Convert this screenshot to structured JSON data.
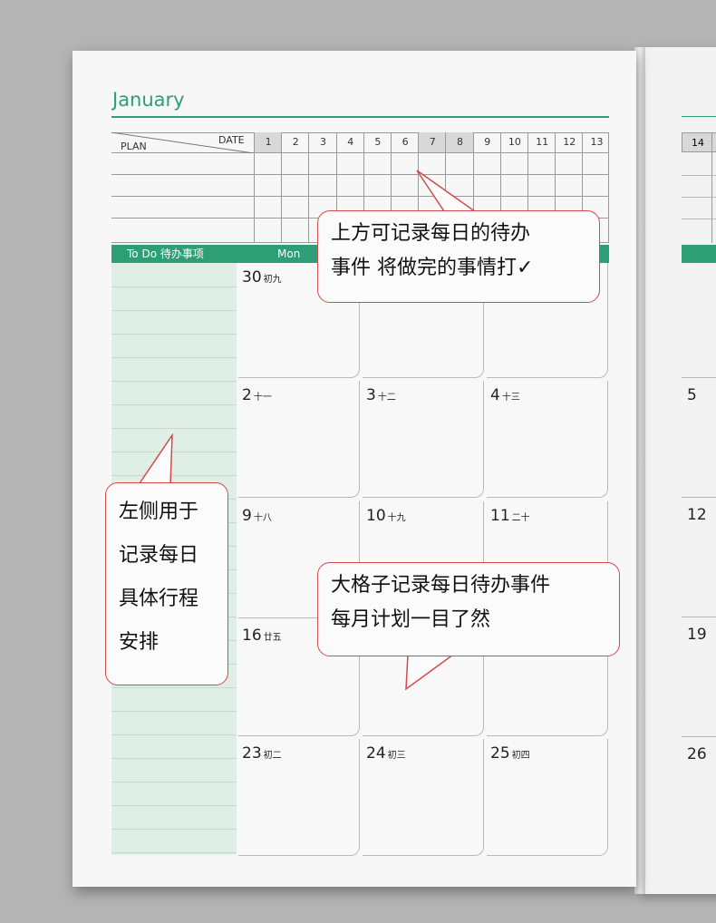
{
  "month": "January",
  "plan_table": {
    "date_label": "DATE",
    "plan_label": "PLAN",
    "days": [
      "1",
      "2",
      "3",
      "4",
      "5",
      "6",
      "7",
      "8",
      "9",
      "10",
      "11",
      "12",
      "13"
    ],
    "shaded": [
      "1",
      "7",
      "8"
    ]
  },
  "header": {
    "todo_label": "To Do  待办事项",
    "weekday_mon": "Mon"
  },
  "calendar": {
    "rows": [
      [
        {
          "day": "30",
          "lunar": "初九"
        }
      ],
      [
        {
          "day": "2",
          "lunar": "十一"
        },
        {
          "day": "3",
          "lunar": "十二"
        },
        {
          "day": "4",
          "lunar": "十三"
        }
      ],
      [
        {
          "day": "9",
          "lunar": "十八"
        },
        {
          "day": "10",
          "lunar": "十九"
        },
        {
          "day": "11",
          "lunar": "二十"
        }
      ],
      [
        {
          "day": "16",
          "lunar": "廿五"
        }
      ],
      [
        {
          "day": "23",
          "lunar": "初二"
        },
        {
          "day": "24",
          "lunar": "初三"
        },
        {
          "day": "25",
          "lunar": "初四"
        }
      ]
    ]
  },
  "right_page": {
    "first_date": "14",
    "days": [
      "5",
      "12",
      "19",
      "26"
    ]
  },
  "callouts": {
    "top": [
      "上方可记录每日的待办",
      "事件 将做完的事情打✓"
    ],
    "left": [
      "左侧用于",
      "记录每日",
      "具体行程",
      "安排"
    ],
    "bottom": [
      "大格子记录每日待办事件",
      "每月计划一目了然"
    ]
  },
  "colors": {
    "accent": "#2e9e77",
    "callout_border": "#d34a4a",
    "todo_fill": "#e0efe6"
  }
}
